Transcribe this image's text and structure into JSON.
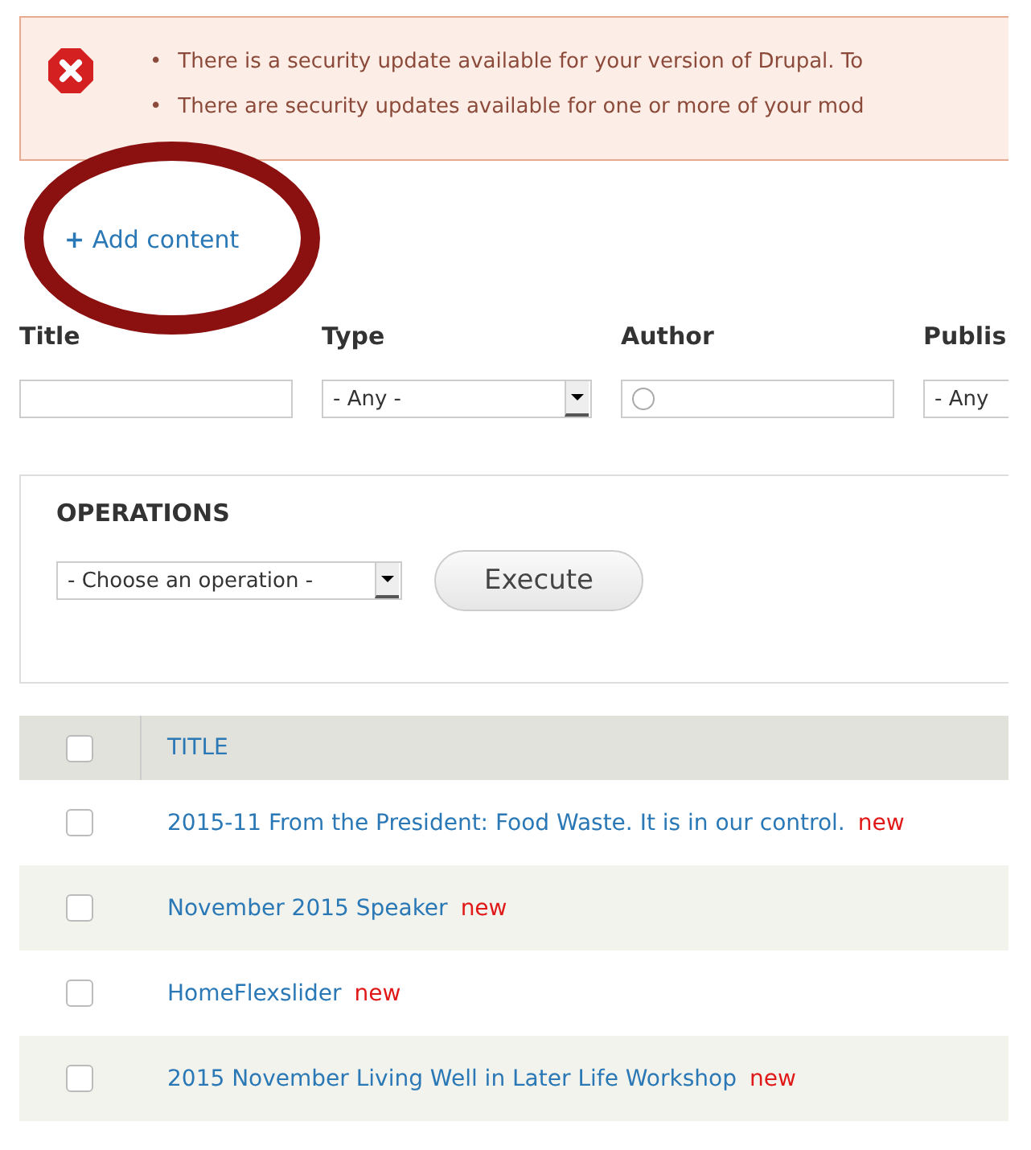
{
  "alert": {
    "messages": [
      {
        "bullet": "•",
        "text": "There is a security update available for your version of Drupal. To"
      },
      {
        "bullet": "•",
        "text": "There are security updates available for one or more of your mod"
      }
    ]
  },
  "add_link": {
    "icon": "+",
    "label": "Add content"
  },
  "filters": [
    {
      "label": "Title",
      "kind": "text"
    },
    {
      "label": "Type",
      "kind": "select",
      "value": "- Any -"
    },
    {
      "label": "Author",
      "kind": "autocomplete"
    },
    {
      "label": "Publis",
      "kind": "select",
      "value": "- Any"
    }
  ],
  "operations": {
    "title": "OPERATIONS",
    "select": "- Choose an operation -",
    "button": "Execute"
  },
  "table": {
    "header": {
      "checked": false,
      "title": "TITLE"
    },
    "rows": [
      {
        "checked": false,
        "title": "2015-11 From the President: Food Waste. It is in our control.",
        "badge": "new"
      },
      {
        "checked": false,
        "title": "November 2015 Speaker",
        "badge": "new"
      },
      {
        "checked": false,
        "title": "HomeFlexslider",
        "badge": "new"
      },
      {
        "checked": false,
        "title": "2015 November Living Well in Later Life Workshop",
        "badge": "new"
      }
    ]
  }
}
